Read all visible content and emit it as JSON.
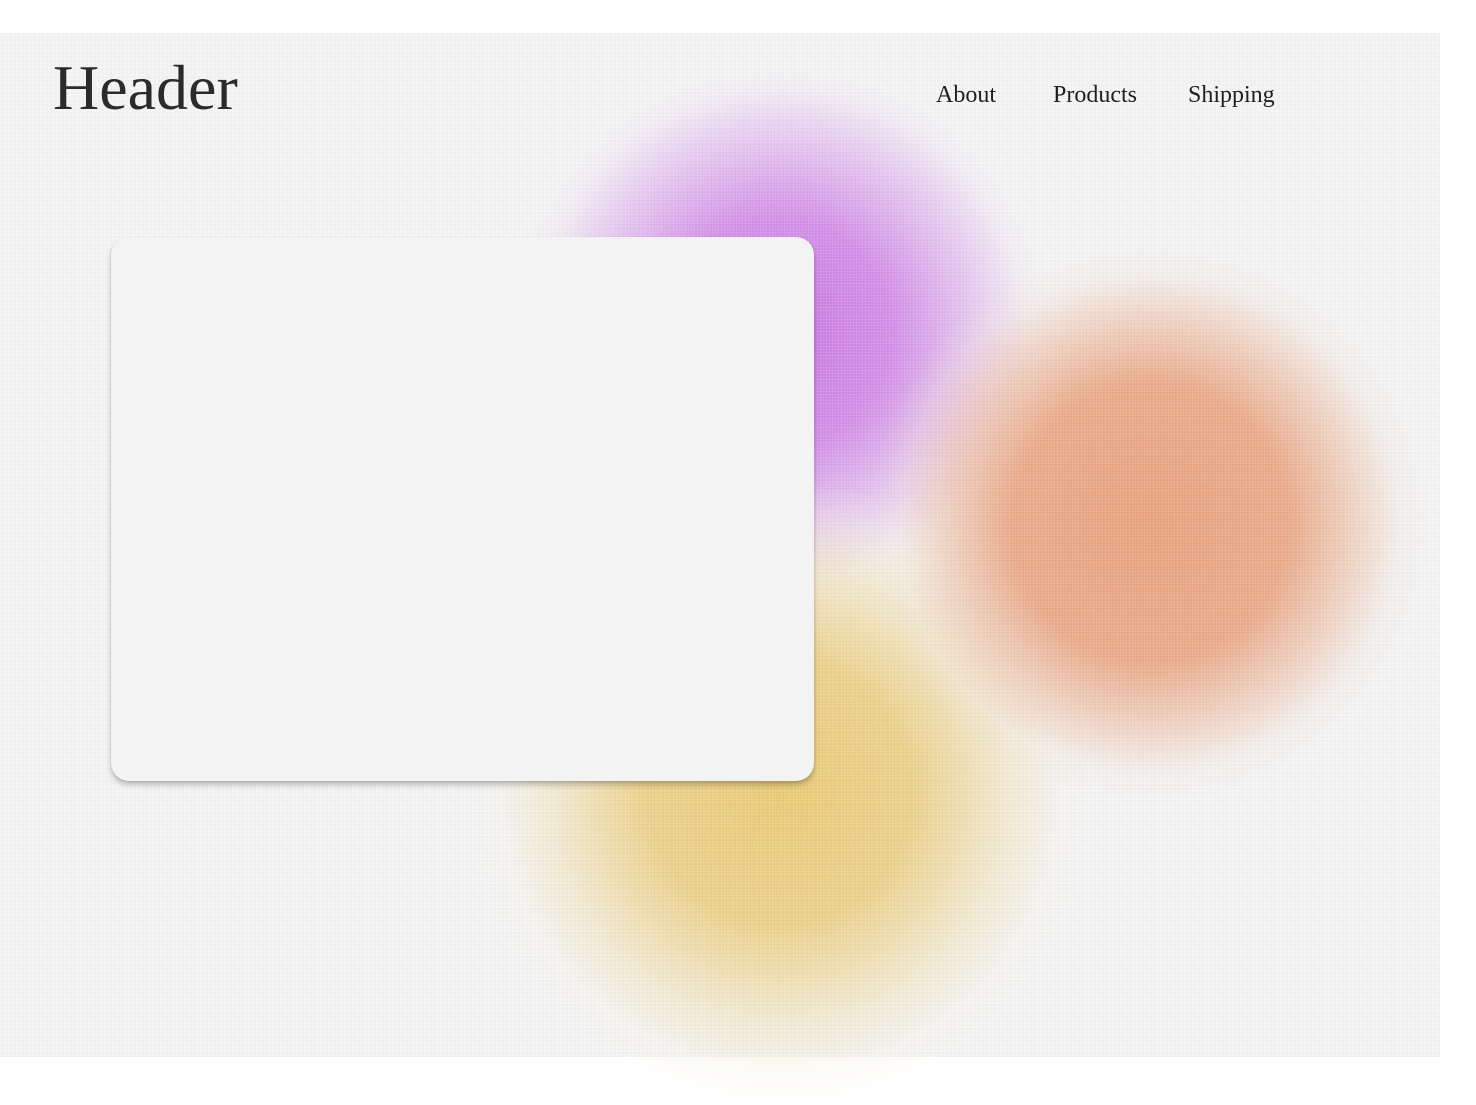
{
  "header": {
    "title": "Header",
    "nav": [
      {
        "label": "About"
      },
      {
        "label": "Products"
      },
      {
        "label": "Shipping"
      }
    ]
  },
  "theme": {
    "background": "#f3f3f3",
    "blob_colors": [
      "#c770e2",
      "#e8a07a",
      "#e9c76e"
    ]
  }
}
